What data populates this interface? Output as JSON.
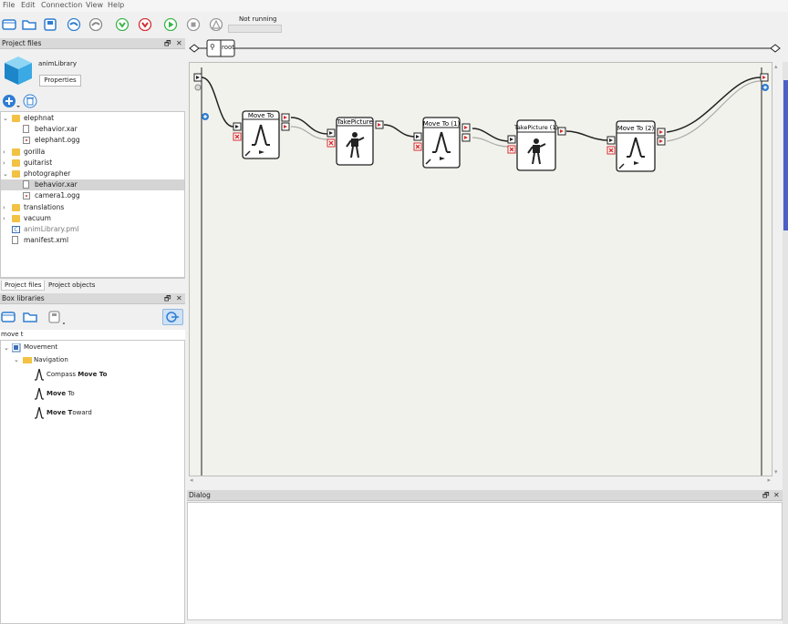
{
  "menu": [
    "File",
    "Edit",
    "Connection",
    "View",
    "Help"
  ],
  "toolbar": {
    "status": "Not running"
  },
  "project_files": {
    "title": "Project files",
    "library_name": "animLibrary",
    "properties_label": "Properties",
    "tree": [
      {
        "label": "elephnat",
        "type": "folder",
        "expanded": true,
        "depth": 0
      },
      {
        "label": "behavior.xar",
        "type": "file",
        "depth": 1
      },
      {
        "label": "elephant.ogg",
        "type": "ogg",
        "depth": 1
      },
      {
        "label": "gorilla",
        "type": "folder",
        "expanded": false,
        "depth": 0
      },
      {
        "label": "guitarist",
        "type": "folder",
        "expanded": false,
        "depth": 0
      },
      {
        "label": "photographer",
        "type": "folder",
        "expanded": true,
        "depth": 0
      },
      {
        "label": "behavior.xar",
        "type": "file",
        "depth": 1,
        "selected": true
      },
      {
        "label": "camera1.ogg",
        "type": "ogg",
        "depth": 1
      },
      {
        "label": "translations",
        "type": "folder",
        "expanded": false,
        "depth": 0
      },
      {
        "label": "vacuum",
        "type": "folder",
        "expanded": false,
        "depth": 0
      },
      {
        "label": "animLibrary.pml",
        "type": "pml",
        "depth": 0
      },
      {
        "label": "manifest.xml",
        "type": "file",
        "depth": 0
      }
    ],
    "tabs": [
      "Project files",
      "Project objects"
    ]
  },
  "box_libraries": {
    "title": "Box libraries",
    "search": "move t",
    "tree": [
      {
        "label": "Movement",
        "depth": 0
      },
      {
        "label": "Navigation",
        "depth": 1
      },
      {
        "label_plain": "Compass ",
        "label_bold": "Move To",
        "label_rest": ""
      },
      {
        "label_plain": "",
        "label_bold": "Move",
        "label_rest": " To"
      },
      {
        "label_plain": "",
        "label_bold": "Move T",
        "label_rest": "oward"
      }
    ]
  },
  "graph": {
    "breadcrumb": "root",
    "boxes": [
      "Move To",
      "TakePicture",
      "Move To (1)",
      "TakePicture (1)",
      "Move To (2)"
    ]
  },
  "dialog": {
    "title": "Dialog"
  },
  "colors": {
    "accent": "#2f7dd1",
    "folder": "#f2c244",
    "stop_red": "#d32f2f"
  }
}
